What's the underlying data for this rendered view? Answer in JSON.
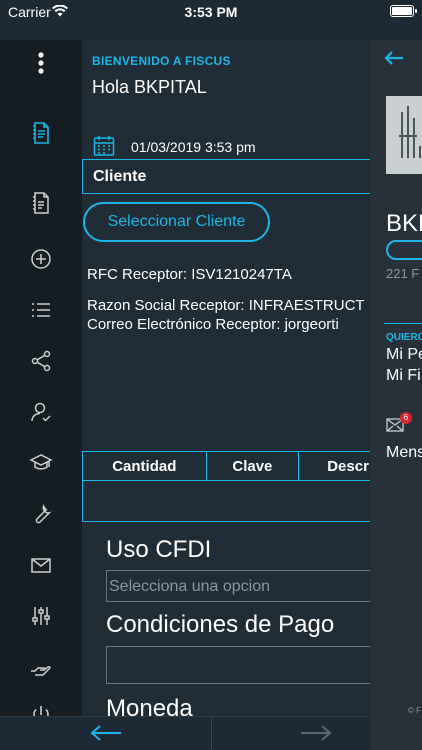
{
  "status_bar": {
    "carrier": "Carrier",
    "time": "3:53 PM"
  },
  "main": {
    "welcome": "BIENVENIDO A FISCUS",
    "greeting": "Hola BKPITAL",
    "datetime": "01/03/2019 3:53 pm",
    "section_title": "Cliente",
    "select_client_label": "Seleccionar Cliente",
    "rfc_receptor": "RFC Receptor: ISV1210247TA",
    "razon_social": "Razon Social Receptor: INFRAESTRUCT",
    "correo": "Correo Electrónico Receptor: jorgeorti",
    "table_headers": [
      "Cantidad",
      "Clave",
      "Descr"
    ],
    "uso_cfdi_label": "Uso CFDI",
    "uso_cfdi_placeholder": "Selecciona una opcion",
    "condiciones_label": "Condiciones de Pago",
    "moneda_label": "Moneda"
  },
  "right_panel": {
    "name": "BKF",
    "subtitle": "221 F",
    "quiero": "QUIERO",
    "links": [
      "Mi Pe",
      "Mi Fi"
    ],
    "badge_count": "6",
    "messages": "Mens",
    "copyright": "© F"
  },
  "sidebar": {
    "icons": [
      "menu-dots-icon",
      "invoice-icon",
      "document-icon",
      "add-circle-icon",
      "list-icon",
      "share-icon",
      "user-check-icon",
      "graduation-cap-icon",
      "wrench-icon",
      "mail-icon",
      "sliders-icon",
      "hand-icon",
      "power-icon"
    ],
    "active": "invoice-icon"
  },
  "colors": {
    "accent": "#1ab6e8",
    "background": "#202d37",
    "sidebar": "#151d22",
    "badge": "#d9262c"
  }
}
